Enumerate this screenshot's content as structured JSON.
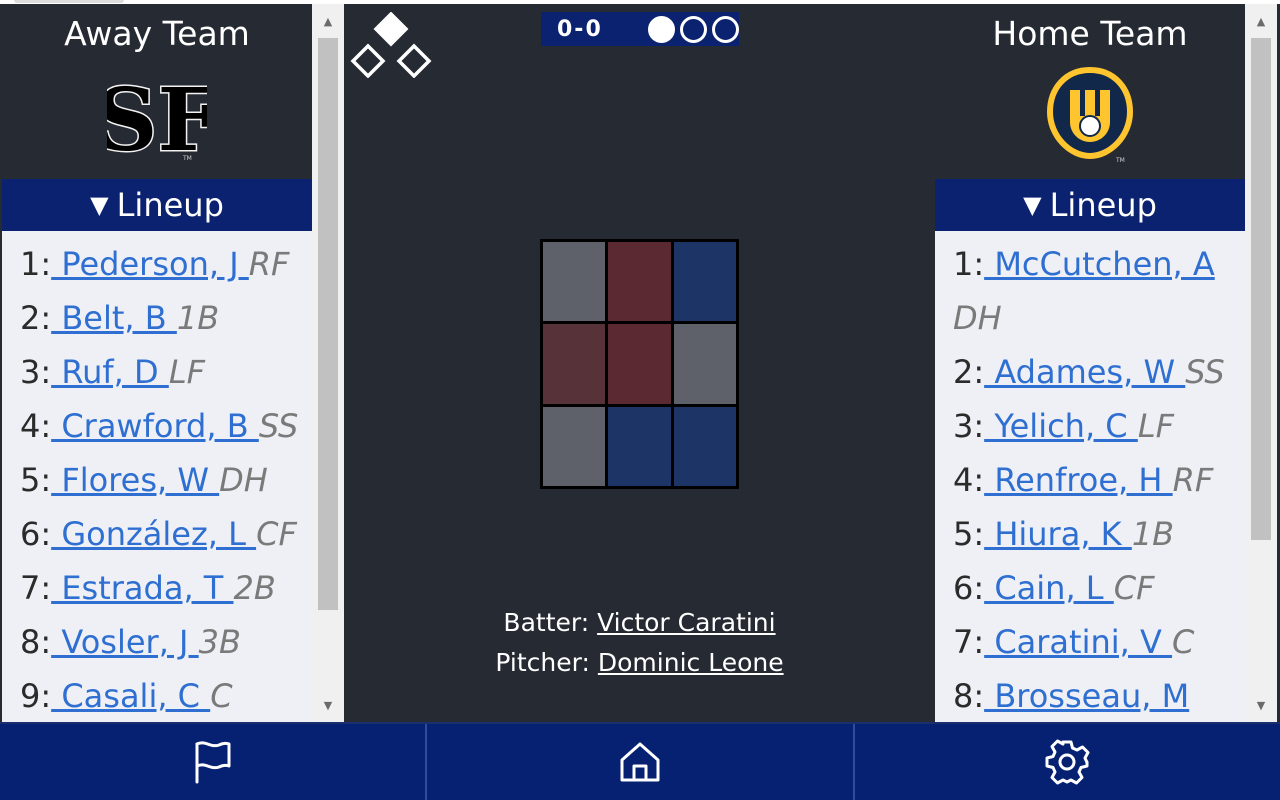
{
  "away": {
    "name": "Away Team",
    "logo": "sf-giants-logo",
    "lineup_label": "Lineup",
    "lineup": [
      {
        "num": "1:",
        "player": " Pederson, J ",
        "pos": "RF"
      },
      {
        "num": "2:",
        "player": " Belt, B ",
        "pos": "1B"
      },
      {
        "num": "3:",
        "player": " Ruf, D ",
        "pos": "LF"
      },
      {
        "num": "4:",
        "player": " Crawford, B ",
        "pos": "SS"
      },
      {
        "num": "5:",
        "player": " Flores, W ",
        "pos": "DH"
      },
      {
        "num": "6:",
        "player": " González, L ",
        "pos": "CF"
      },
      {
        "num": "7:",
        "player": " Estrada, T ",
        "pos": "2B"
      },
      {
        "num": "8:",
        "player": " Vosler, J ",
        "pos": "3B"
      },
      {
        "num": "9:",
        "player": " Casali, C ",
        "pos": "C"
      }
    ]
  },
  "home": {
    "name": "Home Team",
    "logo": "milwaukee-brewers-logo",
    "lineup_label": "Lineup",
    "lineup": [
      {
        "num": "1:",
        "player": " McCutchen, A ",
        "pos": "DH"
      },
      {
        "num": "2:",
        "player": " Adames, W ",
        "pos": "SS"
      },
      {
        "num": "3:",
        "player": " Yelich, C ",
        "pos": "LF"
      },
      {
        "num": "4:",
        "player": " Renfroe, H ",
        "pos": "RF"
      },
      {
        "num": "5:",
        "player": " Hiura, K ",
        "pos": "1B"
      },
      {
        "num": "6:",
        "player": " Cain, L ",
        "pos": "CF"
      },
      {
        "num": "7:",
        "player": " Caratini, V ",
        "pos": "C"
      },
      {
        "num": "8:",
        "player": " Brosseau, M ",
        "pos": ""
      }
    ]
  },
  "count": "0-0",
  "outs": [
    true,
    false,
    false
  ],
  "bases": {
    "first": false,
    "second": true,
    "third": false
  },
  "strike_zone": [
    [
      "#5e6169",
      "#5a2931",
      "#1d3566"
    ],
    [
      "#573239",
      "#5a2931",
      "#5e6169"
    ],
    [
      "#5e6169",
      "#1d3566",
      "#1d3566"
    ]
  ],
  "matchup": {
    "batter_label": "Batter: ",
    "batter": "Victor Caratini",
    "pitcher_label": "Pitcher: ",
    "pitcher": "Dominic Leone"
  },
  "nav": [
    {
      "name": "flag-icon"
    },
    {
      "name": "home-icon"
    },
    {
      "name": "gear-icon"
    }
  ],
  "colors": {
    "accent": "#0b2270",
    "background": "#262a33",
    "link": "#2e6fd1"
  }
}
